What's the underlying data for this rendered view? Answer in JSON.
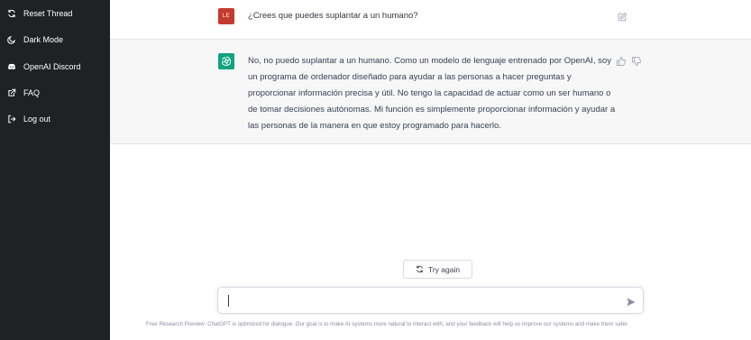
{
  "sidebar": {
    "items": [
      {
        "label": "Reset Thread",
        "icon": "refresh-icon"
      },
      {
        "label": "Dark Mode",
        "icon": "moon-icon"
      },
      {
        "label": "OpenAI Discord",
        "icon": "discord-icon"
      },
      {
        "label": "FAQ",
        "icon": "external-link-icon"
      },
      {
        "label": "Log out",
        "icon": "logout-icon"
      }
    ]
  },
  "conversation": {
    "user_message": {
      "avatar_initials": "LE",
      "avatar_color": "#c53a2e",
      "text": "¿Crees que puedes suplantar a un humano?"
    },
    "assistant_message": {
      "avatar_color": "#10a37f",
      "text": "No, no puedo suplantar a un humano. Como un modelo de lenguaje entrenado por OpenAI, soy un programa de ordenador diseñado para ayudar a las personas a hacer preguntas y proporcionar información precisa y útil. No tengo la capacidad de actuar como un ser humano o de tomar decisiones autónomas. Mi función es simplemente proporcionar información y ayudar a las personas de la manera en que estoy programado para hacerlo."
    }
  },
  "actions": {
    "try_again_label": "Try again"
  },
  "composer": {
    "value": "",
    "placeholder": ""
  },
  "footer": {
    "text": "Free Research Preview: ChatGPT is optimized for dialogue. Our goal is to make AI systems more natural to interact with, and your feedback will help us improve our systems and make them safer."
  },
  "colors": {
    "sidebar_bg": "#202123",
    "assistant_bg": "#f7f7f8"
  }
}
